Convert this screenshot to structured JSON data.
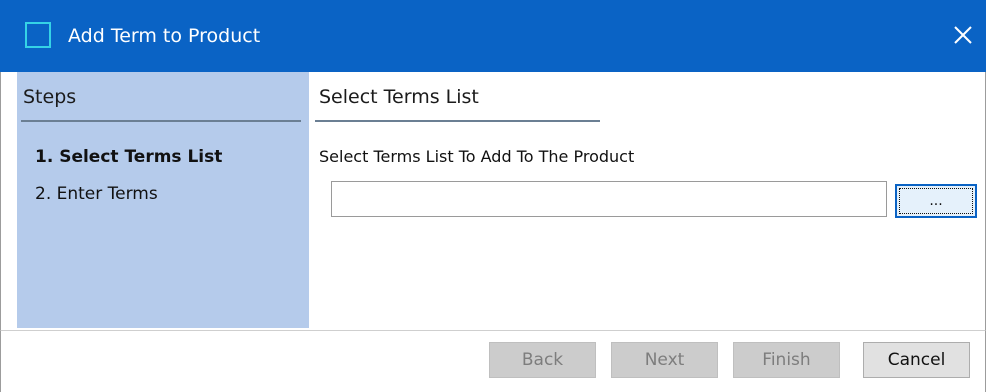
{
  "window": {
    "title": "Add Term to Product",
    "close_icon": "close-icon"
  },
  "steps": {
    "title": "Steps",
    "items": [
      {
        "label": "1. Select Terms List",
        "active": true
      },
      {
        "label": "2. Enter Terms",
        "active": false
      }
    ]
  },
  "content": {
    "title": "Select Terms List",
    "instruction": "Select Terms List To Add To The Product",
    "terms_input": {
      "value": "",
      "placeholder": ""
    },
    "browse_label": "..."
  },
  "footer": {
    "back_label": "Back",
    "next_label": "Next",
    "finish_label": "Finish",
    "cancel_label": "Cancel"
  },
  "colors": {
    "titlebar": "#0a63c5",
    "steps_panel": "#b5cbeb",
    "focus_border": "#0a63c5"
  }
}
